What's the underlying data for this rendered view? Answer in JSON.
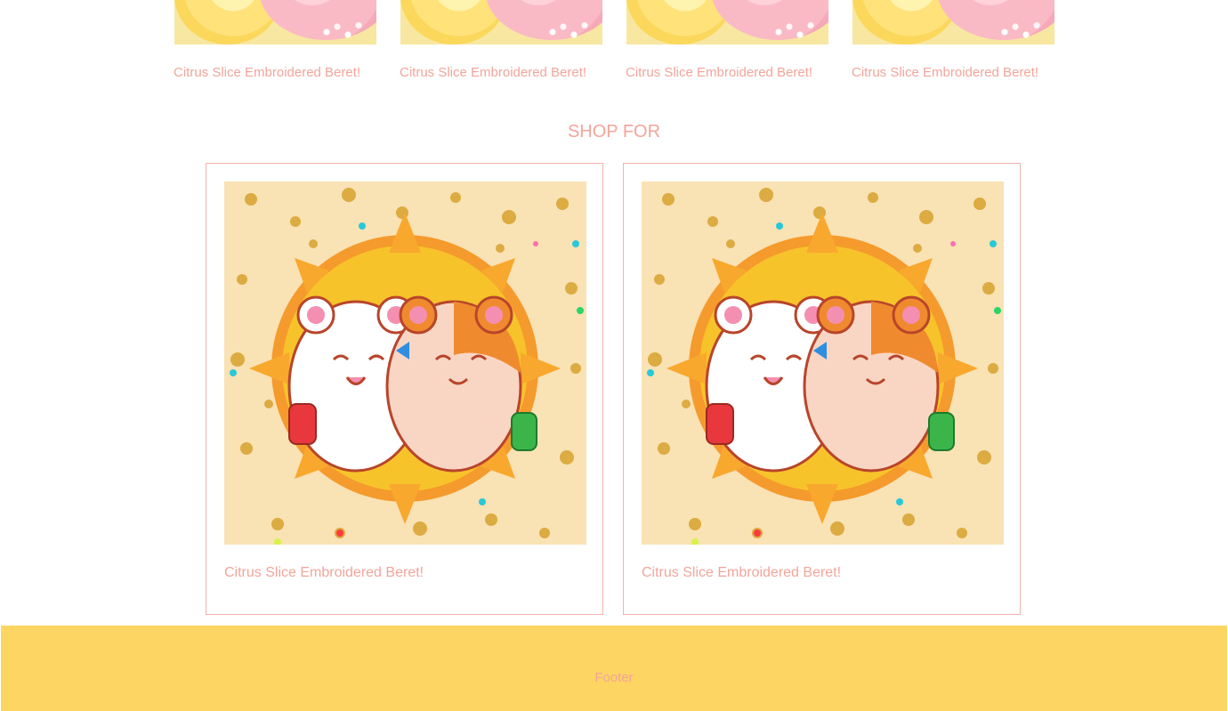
{
  "top_products": [
    {
      "title": "Citrus Slice Embroidered Beret!"
    },
    {
      "title": "Citrus Slice Embroidered Beret!"
    },
    {
      "title": "Citrus Slice Embroidered Beret!"
    },
    {
      "title": "Citrus Slice Embroidered Beret!"
    }
  ],
  "shop_for": {
    "heading": "SHOP FOR",
    "cards": [
      {
        "title": "Citrus Slice Embroidered Beret!"
      },
      {
        "title": "Citrus Slice Embroidered Beret!"
      }
    ]
  },
  "footer": {
    "label": "Footer"
  },
  "colors": {
    "accent_text": "#f2a59b",
    "card_border": "#f2b3ab",
    "footer_bg": "#fdd562"
  }
}
